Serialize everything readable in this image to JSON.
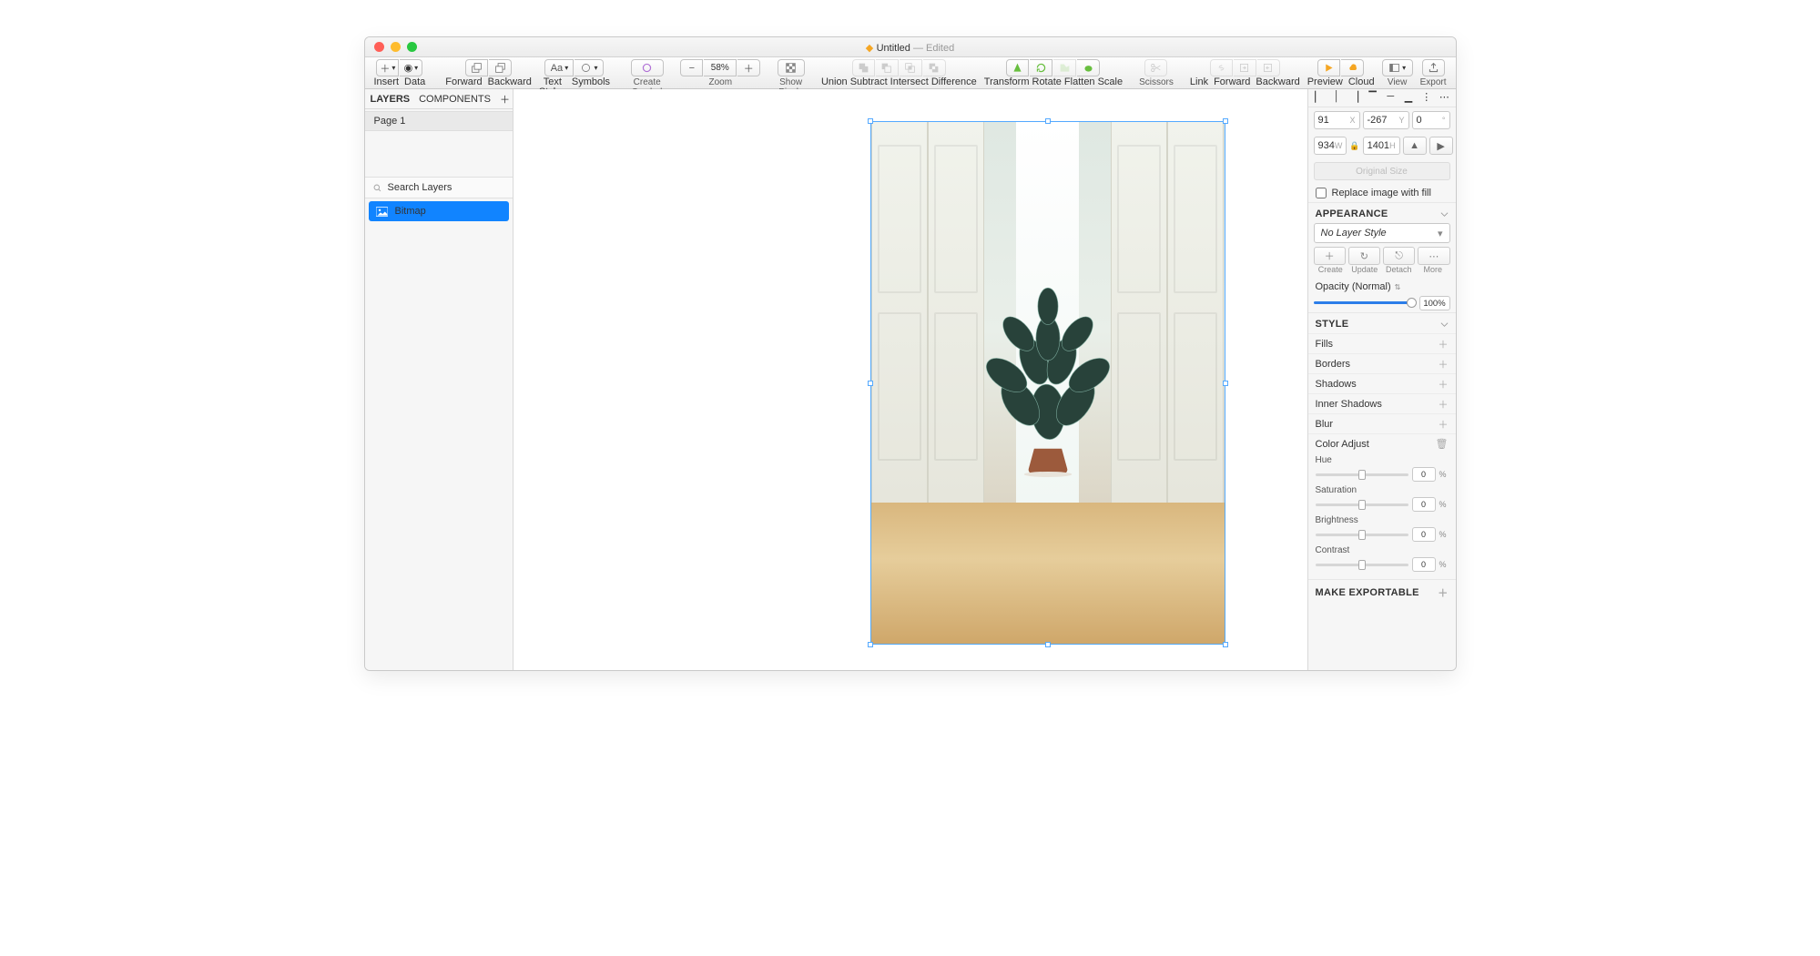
{
  "window_title": "Untitled",
  "window_state": " — Edited",
  "toolbar": {
    "insert": "Insert",
    "data": "Data",
    "forward": "Forward",
    "backward": "Backward",
    "text_styles": "Text Styles",
    "symbols": "Symbols",
    "create_symbol": "Create Symbol",
    "zoom_label": "Zoom",
    "zoom_value": "58%",
    "show_pixels": "Show Pixels",
    "union": "Union",
    "subtract": "Subtract",
    "intersect": "Intersect",
    "difference": "Difference",
    "transform": "Transform",
    "rotate": "Rotate",
    "flatten": "Flatten",
    "scale": "Scale",
    "scissors": "Scissors",
    "link": "Link",
    "forward2": "Forward",
    "backward2": "Backward",
    "preview": "Preview",
    "cloud": "Cloud",
    "view": "View",
    "export": "Export"
  },
  "left_panel": {
    "tab_layers": "LAYERS",
    "tab_components": "COMPONENTS",
    "page1": "Page 1",
    "search_placeholder": "Search Layers",
    "layer_name": "Bitmap"
  },
  "inspector": {
    "x": "91",
    "x_lab": "X",
    "y": "-267",
    "y_lab": "Y",
    "rot": "0",
    "w": "934",
    "w_lab": "W",
    "h": "1401",
    "h_lab": "H",
    "original_size": "Original Size",
    "replace_label": "Replace image with fill",
    "appearance": "APPEARANCE",
    "layer_style": "No Layer Style",
    "create": "Create",
    "update": "Update",
    "detach": "Detach",
    "more": "More",
    "opacity_label": "Opacity (Normal)",
    "opacity_value": "100%",
    "style": "STYLE",
    "fills": "Fills",
    "borders": "Borders",
    "shadows": "Shadows",
    "inner_shadows": "Inner Shadows",
    "blur": "Blur",
    "color_adjust": "Color Adjust",
    "hue": "Hue",
    "sat": "Saturation",
    "bri": "Brightness",
    "con": "Contrast",
    "adj_val": "0",
    "adj_pct": "%",
    "exportable": "MAKE EXPORTABLE"
  }
}
